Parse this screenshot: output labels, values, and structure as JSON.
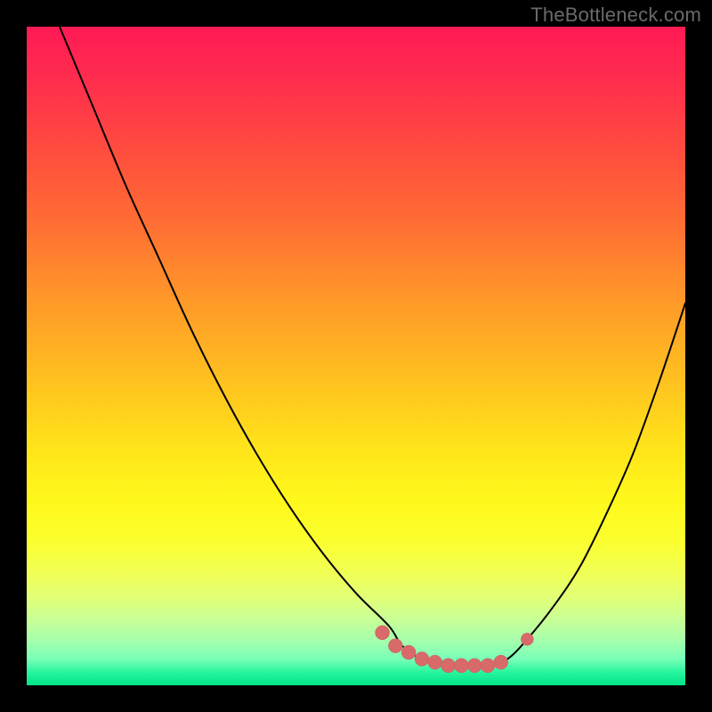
{
  "watermark": "TheBottleneck.com",
  "colors": {
    "curve": "#000000",
    "marker": "#d86a6a",
    "marker_stroke": "#c95c5c"
  },
  "chart_data": {
    "type": "line",
    "title": "",
    "xlabel": "",
    "ylabel": "",
    "xlim": [
      0,
      100
    ],
    "ylim": [
      0,
      100
    ],
    "grid": false,
    "legend": false,
    "description": "V-shaped bottleneck curve over rainbow gradient; minimum plateau ~x=57-73 at y≈96; left branch starts at (5,0); right branch ends at (100,42).",
    "series": [
      {
        "name": "bottleneck",
        "x": [
          5,
          10,
          15,
          20,
          25,
          30,
          35,
          40,
          45,
          50,
          55,
          57,
          60,
          65,
          70,
          73,
          76,
          80,
          84,
          88,
          92,
          96,
          100
        ],
        "y": [
          0,
          12,
          24,
          35,
          46,
          56,
          65,
          73,
          80,
          86,
          91,
          94,
          96,
          97,
          97,
          96,
          93,
          88,
          82,
          74,
          65,
          54,
          42
        ]
      }
    ],
    "markers": {
      "comment": "Thick salmon bumpy segment near the trough plus one isolated dot on the rising right branch",
      "thick_segment": {
        "x": [
          54,
          56,
          58,
          60,
          62,
          64,
          66,
          68,
          70,
          72
        ],
        "y": [
          92,
          94,
          95,
          96,
          96.5,
          97,
          97,
          97,
          97,
          96.5
        ],
        "radius": 8
      },
      "dot": {
        "x": 76,
        "y": 93,
        "radius": 7
      }
    }
  }
}
